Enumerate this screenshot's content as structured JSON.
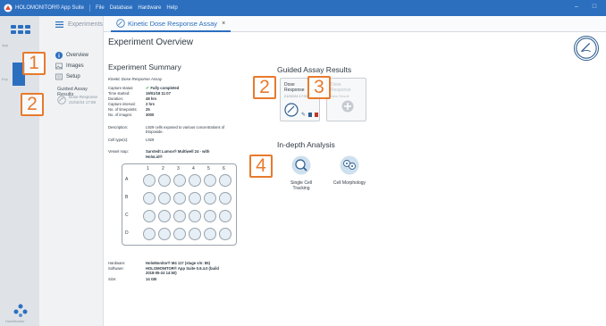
{
  "titlebar": {
    "app": "HOLOMONITOR® App Suite",
    "menus": [
      "File",
      "Database",
      "Hardware",
      "Help"
    ]
  },
  "rail": {
    "labels": [
      "App",
      "Exp"
    ],
    "holomonitor_label": "HoloMonitor"
  },
  "tabs": {
    "experiments": "Experiments",
    "active": "Kinetic Dose Response Assay",
    "close": "×"
  },
  "subnav": {
    "items": [
      {
        "label": "Overview",
        "icon": "info-icon"
      },
      {
        "label": "Images",
        "icon": "images-icon"
      },
      {
        "label": "Setup",
        "icon": "setup-icon"
      }
    ],
    "guided_title": "Guided Assay Results",
    "guided_item": {
      "title": "Dose Response",
      "date": "21/02/24 17:59"
    }
  },
  "overview": {
    "title": "Experiment Overview",
    "summary_title": "Experiment Summary",
    "assay": "Kinetic Dose Response Assay",
    "fields": [
      {
        "k": "Capture status:",
        "v": "Fully completed"
      },
      {
        "k": "Time started:",
        "v": "19/01/18 11:07"
      },
      {
        "k": "Duration:",
        "v": "48 hrs"
      },
      {
        "k": "Capture interval:",
        "v": "2 hrs"
      },
      {
        "k": "No. of timepoints:",
        "v": "25"
      },
      {
        "k": "No. of images:",
        "v": "3000"
      }
    ],
    "description_label": "Description:",
    "description": [
      "L929 cells exposed to various concentrations of",
      "Etoposide."
    ],
    "celltype_label": "Cell type(s):",
    "celltype": "L929",
    "vessel_label": "Vessel map:",
    "vessel": [
      "Sarstedt Lumox® Multiwell 24 - with",
      "HoloLid®"
    ],
    "plate": {
      "cols": [
        "1",
        "2",
        "3",
        "4",
        "5",
        "6"
      ],
      "rows": [
        "A",
        "B",
        "C",
        "D"
      ]
    },
    "hardware_label": "Hardware:",
    "hardware": "HoloMonitor® M4 117 (stage s/n: 85)",
    "software_label": "Software:",
    "software": [
      "HOLOMONITOR® App Suite 0.9.4.0 (build",
      "2018-05-24 14:50)"
    ],
    "size_label": "Size:",
    "size": "14 GB"
  },
  "guided": {
    "title": "Guided Assay Results",
    "tile1": {
      "title": [
        "Dose",
        "Response"
      ],
      "date": "21/02/24 17:59"
    },
    "tile2": {
      "title": [
        "Dose",
        "Response"
      ],
      "date": "New Result"
    }
  },
  "indepth": {
    "title": "In-depth Analysis",
    "items": [
      {
        "label": [
          "Single Cell",
          "Tracking"
        ],
        "icon": "magnifier-icon"
      },
      {
        "label": [
          "Cell Morphology"
        ],
        "icon": "cells-icon"
      }
    ]
  },
  "badges": [
    "1",
    "2",
    "2",
    "3",
    "4"
  ],
  "colors": {
    "accent": "#2c6fbf",
    "badge": "#e87a2d",
    "success": "#3aa245"
  }
}
